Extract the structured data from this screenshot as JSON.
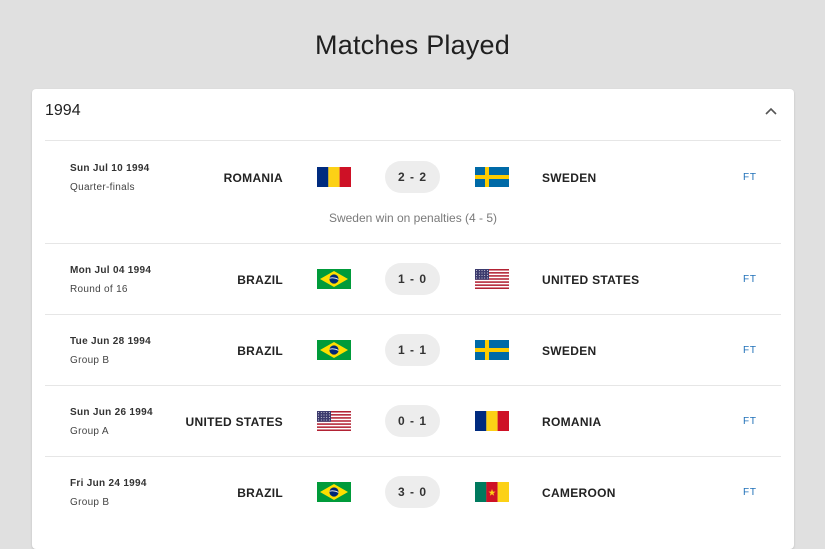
{
  "page": {
    "title": "Matches Played"
  },
  "section": {
    "year": "1994"
  },
  "matches": [
    {
      "date": "Sun Jul 10 1994",
      "round": "Quarter-finals",
      "home": "ROMANIA",
      "home_flag": "romania",
      "score": "2 - 2",
      "away": "SWEDEN",
      "away_flag": "sweden",
      "status": "FT",
      "note": "Sweden win on penalties (4 - 5)"
    },
    {
      "date": "Mon Jul 04 1994",
      "round": "Round of 16",
      "home": "BRAZIL",
      "home_flag": "brazil",
      "score": "1 - 0",
      "away": "UNITED STATES",
      "away_flag": "usa",
      "status": "FT"
    },
    {
      "date": "Tue Jun 28 1994",
      "round": "Group B",
      "home": "BRAZIL",
      "home_flag": "brazil",
      "score": "1 - 1",
      "away": "SWEDEN",
      "away_flag": "sweden",
      "status": "FT"
    },
    {
      "date": "Sun Jun 26 1994",
      "round": "Group A",
      "home": "UNITED STATES",
      "home_flag": "usa",
      "score": "0 - 1",
      "away": "ROMANIA",
      "away_flag": "romania",
      "status": "FT"
    },
    {
      "date": "Fri Jun 24 1994",
      "round": "Group B",
      "home": "BRAZIL",
      "home_flag": "brazil",
      "score": "3 - 0",
      "away": "CAMEROON",
      "away_flag": "cameroon",
      "status": "FT"
    }
  ],
  "colors": {
    "background": "#e0e0e0",
    "card": "#ffffff",
    "score_pill": "#ededed",
    "status_link": "#1e6fb8"
  }
}
